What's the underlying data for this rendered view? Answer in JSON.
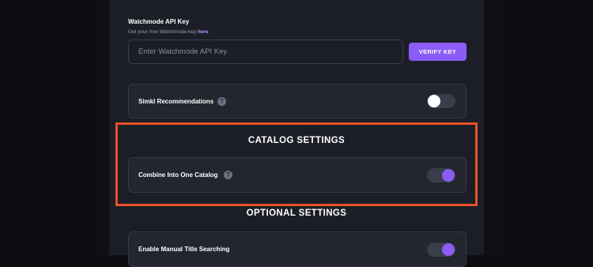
{
  "watchmode": {
    "title": "Watchmode API Key",
    "help_prefix": "Get your free Watchmode key ",
    "help_link": "here",
    "input_value": "",
    "input_placeholder": "Enter Watchmode API Key",
    "verify_label": "VERIFY KEY"
  },
  "simkl": {
    "label": "Simkl Recommendations",
    "help_icon": "?",
    "toggle_state": "off"
  },
  "catalog_settings": {
    "heading": "CATALOG SETTINGS",
    "combine_label": "Combine Into One Catalog",
    "help_icon": "?",
    "toggle_state": "on"
  },
  "optional_settings": {
    "heading": "OPTIONAL SETTINGS",
    "manual_search_label": "Enable Manual Title Searching",
    "toggle_state": "on"
  },
  "colors": {
    "accent": "#8b5cf6",
    "highlight": "#e8502a",
    "panel": "#1c1e27",
    "card": "#23252f"
  }
}
